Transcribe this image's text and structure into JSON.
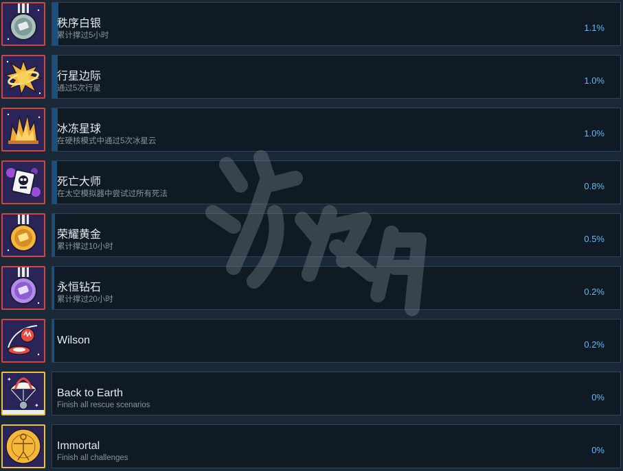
{
  "achievements": [
    {
      "title": "秩序白银",
      "desc": "累计撑过5小时",
      "percent_label": "1.1%",
      "percent": 1.1,
      "icon": "silver-medal-icon",
      "icon_border": "#d2463c",
      "icon_bg": "#2a2459"
    },
    {
      "title": "行星边际",
      "desc": "通过5次行星",
      "percent_label": "1.0%",
      "percent": 1.0,
      "icon": "planet-edge-icon",
      "icon_border": "#d2463c",
      "icon_bg": "#2a2459"
    },
    {
      "title": "冰冻星球",
      "desc": "在硬核模式中通过5次冰星云",
      "percent_label": "1.0%",
      "percent": 1.0,
      "icon": "frozen-planet-icon",
      "icon_border": "#d2463c",
      "icon_bg": "#2a2459"
    },
    {
      "title": "死亡大师",
      "desc": "在太空模拟器中尝试过所有死法",
      "percent_label": "0.8%",
      "percent": 0.8,
      "icon": "death-master-icon",
      "icon_border": "#d2463c",
      "icon_bg": "#2a2459"
    },
    {
      "title": "荣耀黄金",
      "desc": "累计撑过10小时",
      "percent_label": "0.5%",
      "percent": 0.5,
      "icon": "gold-medal-icon",
      "icon_border": "#d2463c",
      "icon_bg": "#2a2459"
    },
    {
      "title": "永恒钻石",
      "desc": "累计撑过20小时",
      "percent_label": "0.2%",
      "percent": 0.2,
      "icon": "diamond-medal-icon",
      "icon_border": "#d2463c",
      "icon_bg": "#2a2459"
    },
    {
      "title": "Wilson",
      "desc": "",
      "percent_label": "0.2%",
      "percent": 0.2,
      "icon": "wilson-icon",
      "icon_border": "#d2463c",
      "icon_bg": "#2a2459"
    },
    {
      "title": "Back to Earth",
      "desc": "Finish all rescue scenarios",
      "percent_label": "0%",
      "percent": 0,
      "icon": "parachute-capsule-icon",
      "icon_border": "#f0c23a",
      "icon_bg": "#2a2459"
    },
    {
      "title": "Immortal",
      "desc": "Finish all challenges",
      "percent_label": "0%",
      "percent": 0,
      "icon": "immortal-figure-icon",
      "icon_border": "#f0c23a",
      "icon_bg": "#2a2459"
    }
  ],
  "colors": {
    "background": "#1b2838",
    "panel": "#0f1a24",
    "panel_border": "#2f4556",
    "progress": "#1d4f78",
    "percent_text": "#66b8ef",
    "title_text": "#e6ebef",
    "desc_text": "#8a949d"
  }
}
